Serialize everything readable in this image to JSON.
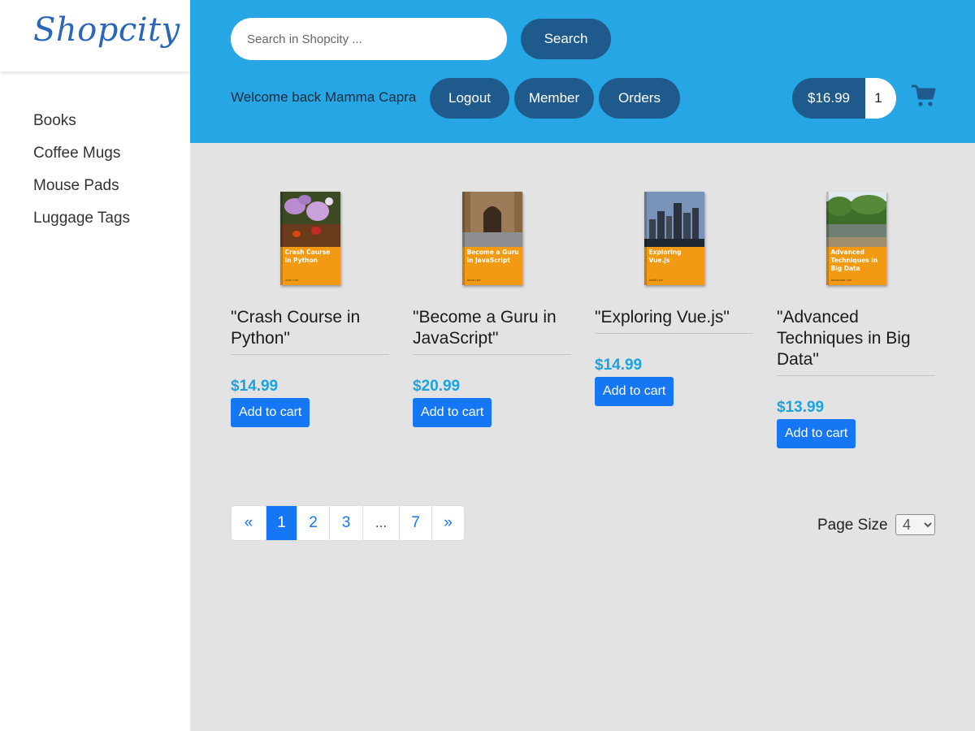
{
  "app": {
    "logo": "Shopcity"
  },
  "sidebar": {
    "items": [
      {
        "label": "Books"
      },
      {
        "label": "Coffee Mugs"
      },
      {
        "label": "Mouse Pads"
      },
      {
        "label": "Luggage Tags"
      }
    ]
  },
  "header": {
    "search": {
      "placeholder": "Search in Shopcity ...",
      "value": "",
      "button_label": "Search"
    },
    "welcome": "Welcome back Mamma Capra",
    "logout_label": "Logout",
    "member_label": "Member",
    "orders_label": "Orders",
    "cart": {
      "total": "$16.99",
      "count": "1",
      "icon": "shopping-cart-icon"
    }
  },
  "products": [
    {
      "title": "\"Crash Course in Python\"",
      "price": "$14.99",
      "button_label": "Add to cart",
      "cover": {
        "title": "Crash Course in Python",
        "author": "John Lee",
        "scene": "purple-flowers"
      }
    },
    {
      "title": "\"Become a Guru in JavaScript\"",
      "price": "$20.99",
      "button_label": "Add to cart",
      "cover": {
        "title": "Become a Guru in JavaScript",
        "author": "Anna Lee",
        "scene": "stone-archway"
      }
    },
    {
      "title": "\"Exploring Vue.js\"",
      "price": "$14.99",
      "button_label": "Add to cart",
      "cover": {
        "title": "Exploring Vue.js",
        "author": "Achill Lee",
        "scene": "city-skyline"
      }
    },
    {
      "title": "\"Advanced Techniques in Big Data\"",
      "price": "$13.99",
      "button_label": "Add to cart",
      "cover": {
        "title": "Advanced Techniques in Big Data",
        "author": "Alexander Lee",
        "scene": "river-forest"
      }
    }
  ],
  "pagination": {
    "prev": "«",
    "pages": [
      "1",
      "2",
      "3",
      "...",
      "7"
    ],
    "next": "»",
    "active": "1"
  },
  "page_size": {
    "label": "Page Size",
    "value": "4"
  },
  "colors": {
    "header_bg": "#26a6e4",
    "pill_bg": "#1f5a8d",
    "price": "#1ba3e0",
    "primary_button": "#1677f5",
    "book_cover": "#f39a14"
  }
}
